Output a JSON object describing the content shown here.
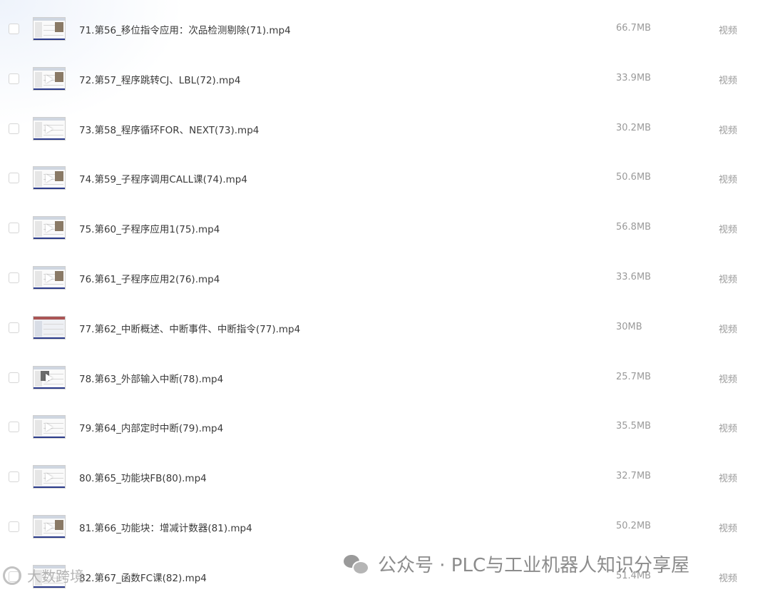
{
  "files": [
    {
      "name": "71.第56_移位指令应用：次品检测剔除(71).mp4",
      "size": "66.7MB",
      "type": "视频",
      "thumb": "photo"
    },
    {
      "name": "72.第57_程序跳转CJ、LBL(72).mp4",
      "size": "33.9MB",
      "type": "视频",
      "thumb": "play"
    },
    {
      "name": "73.第58_程序循环FOR、NEXT(73).mp4",
      "size": "30.2MB",
      "type": "视频",
      "thumb": "play"
    },
    {
      "name": "74.第59_子程序调用CALL课(74).mp4",
      "size": "50.6MB",
      "type": "视频",
      "thumb": "play"
    },
    {
      "name": "75.第60_子程序应用1(75).mp4",
      "size": "56.8MB",
      "type": "视频",
      "thumb": "play"
    },
    {
      "name": "76.第61_子程序应用2(76).mp4",
      "size": "33.6MB",
      "type": "视频",
      "thumb": "play"
    },
    {
      "name": "77.第62_中断概述、中断事件、中断指令(77).mp4",
      "size": "30MB",
      "type": "视频",
      "thumb": "screen"
    },
    {
      "name": "78.第63_外部输入中断(78).mp4",
      "size": "25.7MB",
      "type": "视频",
      "thumb": "play"
    },
    {
      "name": "79.第64_内部定时中断(79).mp4",
      "size": "35.5MB",
      "type": "视频",
      "thumb": "play"
    },
    {
      "name": "80.第65_功能块FB(80).mp4",
      "size": "32.7MB",
      "type": "视频",
      "thumb": "play"
    },
    {
      "name": "81.第66_功能块：增减计数器(81).mp4",
      "size": "50.2MB",
      "type": "视频",
      "thumb": "play"
    },
    {
      "name": "82.第67_函数FC课(82).mp4",
      "size": "51.4MB",
      "type": "视频",
      "thumb": "play"
    }
  ],
  "watermark": {
    "text": "公众号 · PLC与工业机器人知识分享屋",
    "icon": "wechat-icon"
  },
  "corner_mark": {
    "text": "大数跨境",
    "icon": "swirl-logo-icon"
  }
}
